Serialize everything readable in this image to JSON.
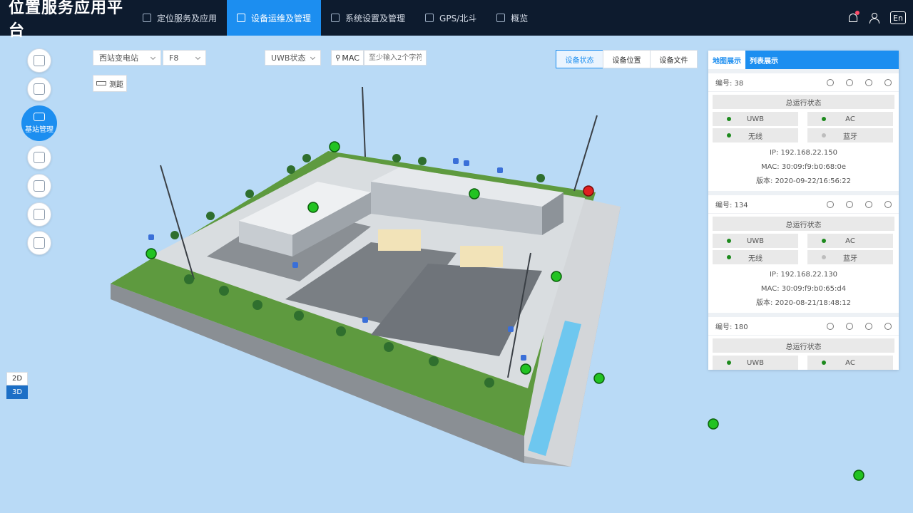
{
  "app": {
    "title": "位置服务应用平台"
  },
  "nav": [
    {
      "label": "定位服务及应用",
      "active": false
    },
    {
      "label": "设备运维及管理",
      "active": true
    },
    {
      "label": "系统设置及管理",
      "active": false
    },
    {
      "label": "GPS/北斗",
      "active": false
    },
    {
      "label": "概览",
      "active": false
    }
  ],
  "topRight": {
    "lang": "En",
    "icons": [
      "bell-icon",
      "user-icon"
    ]
  },
  "sidebar": {
    "activeLabel": "基站管理"
  },
  "toolbar": {
    "substation": "西站变电站",
    "floor": "F8",
    "uwbStatus": "UWB状态",
    "macLabel": "MAC",
    "macPlaceholder": "至少输入2个字符",
    "measure": "测距"
  },
  "segment": {
    "tabs": [
      "设备状态",
      "设备位置",
      "设备文件"
    ],
    "active": 0
  },
  "viewToggle": [
    "2D",
    "3D"
  ],
  "panel": {
    "tabs": [
      "地图展示",
      "列表展示"
    ],
    "statusTitle": "总运行状态",
    "devices": [
      {
        "no": "编号: 38",
        "status": [
          {
            "name": "UWB",
            "color": "#1d8a1d"
          },
          {
            "name": "AC",
            "color": "#1d8a1d"
          },
          {
            "name": "无线",
            "color": "#1d8a1d"
          },
          {
            "name": "蓝牙",
            "color": "#bdbdbd"
          }
        ],
        "ip": "IP: 192.168.22.150",
        "mac": "MAC: 30:09:f9:b0:68:0e",
        "version": "版本: 2020-09-22/16:56:22"
      },
      {
        "no": "编号: 134",
        "status": [
          {
            "name": "UWB",
            "color": "#1d8a1d"
          },
          {
            "name": "AC",
            "color": "#1d8a1d"
          },
          {
            "name": "无线",
            "color": "#1d8a1d"
          },
          {
            "name": "蓝牙",
            "color": "#bdbdbd"
          }
        ],
        "ip": "IP: 192.168.22.130",
        "mac": "MAC: 30:09:f9:b0:65:d4",
        "version": "版本: 2020-08-21/18:48:12"
      },
      {
        "no": "编号: 180",
        "status": [
          {
            "name": "UWB",
            "color": "#1d8a1d"
          },
          {
            "name": "AC",
            "color": "#1d8a1d"
          }
        ]
      }
    ]
  },
  "colors": {
    "accent": "#1c8ef0",
    "nav": "#0d1b2e",
    "online": "#22c322",
    "offline": "#e02020"
  }
}
